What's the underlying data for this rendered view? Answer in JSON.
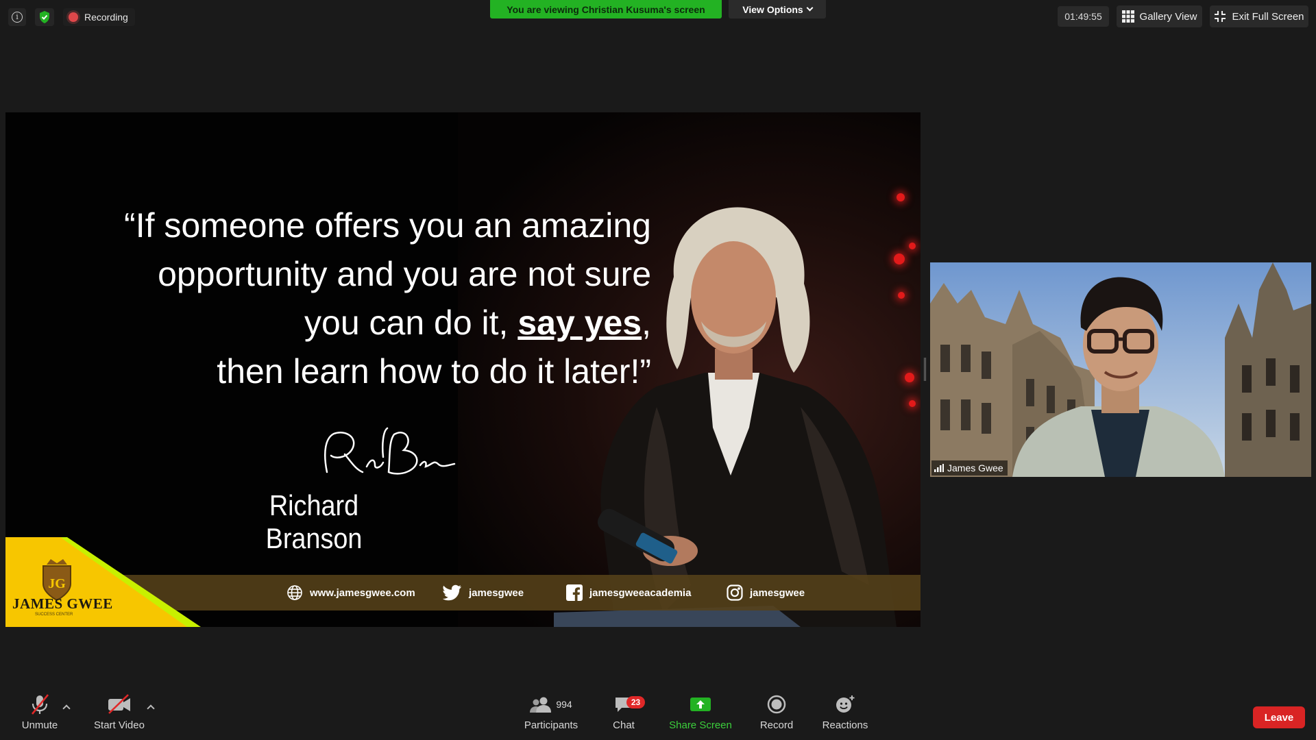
{
  "top_bar": {
    "recording_label": "Recording",
    "viewing_banner": "You are viewing Christian Kusuma's screen",
    "view_options_label": "View Options",
    "timer": "01:49:55",
    "gallery_view_label": "Gallery View",
    "exit_full_screen_label": "Exit Full Screen"
  },
  "slide": {
    "quote_line1": "“If someone offers you an amazing",
    "quote_line2": "opportunity and you are not sure",
    "quote_line3_pre": "you can do it, ",
    "quote_line3_emph": "say yes",
    "quote_line3_post": ",",
    "quote_line4": "then learn how to do it later!”",
    "author": "Richard Branson",
    "logo_name": "JAMES GWEE",
    "logo_sub": "SUCCESS CENTER",
    "social": {
      "website": "www.jamesgwee.com",
      "twitter": "jamesgwee",
      "facebook": "jamesgweeacademia",
      "instagram": "jamesgwee"
    },
    "colors": {
      "logo_yellow": "#f7c600",
      "logo_lime": "#c8f000",
      "social_bar": "#554119"
    }
  },
  "participant_video": {
    "name": "James Gwee"
  },
  "toolbar": {
    "unmute_label": "Unmute",
    "start_video_label": "Start Video",
    "participants_label": "Participants",
    "participants_count": "994",
    "chat_label": "Chat",
    "chat_badge": "23",
    "share_screen_label": "Share Screen",
    "record_label": "Record",
    "reactions_label": "Reactions",
    "leave_label": "Leave",
    "colors": {
      "share_green": "#23b223",
      "leave_red": "#d92424",
      "muted_red": "#e02828"
    }
  }
}
